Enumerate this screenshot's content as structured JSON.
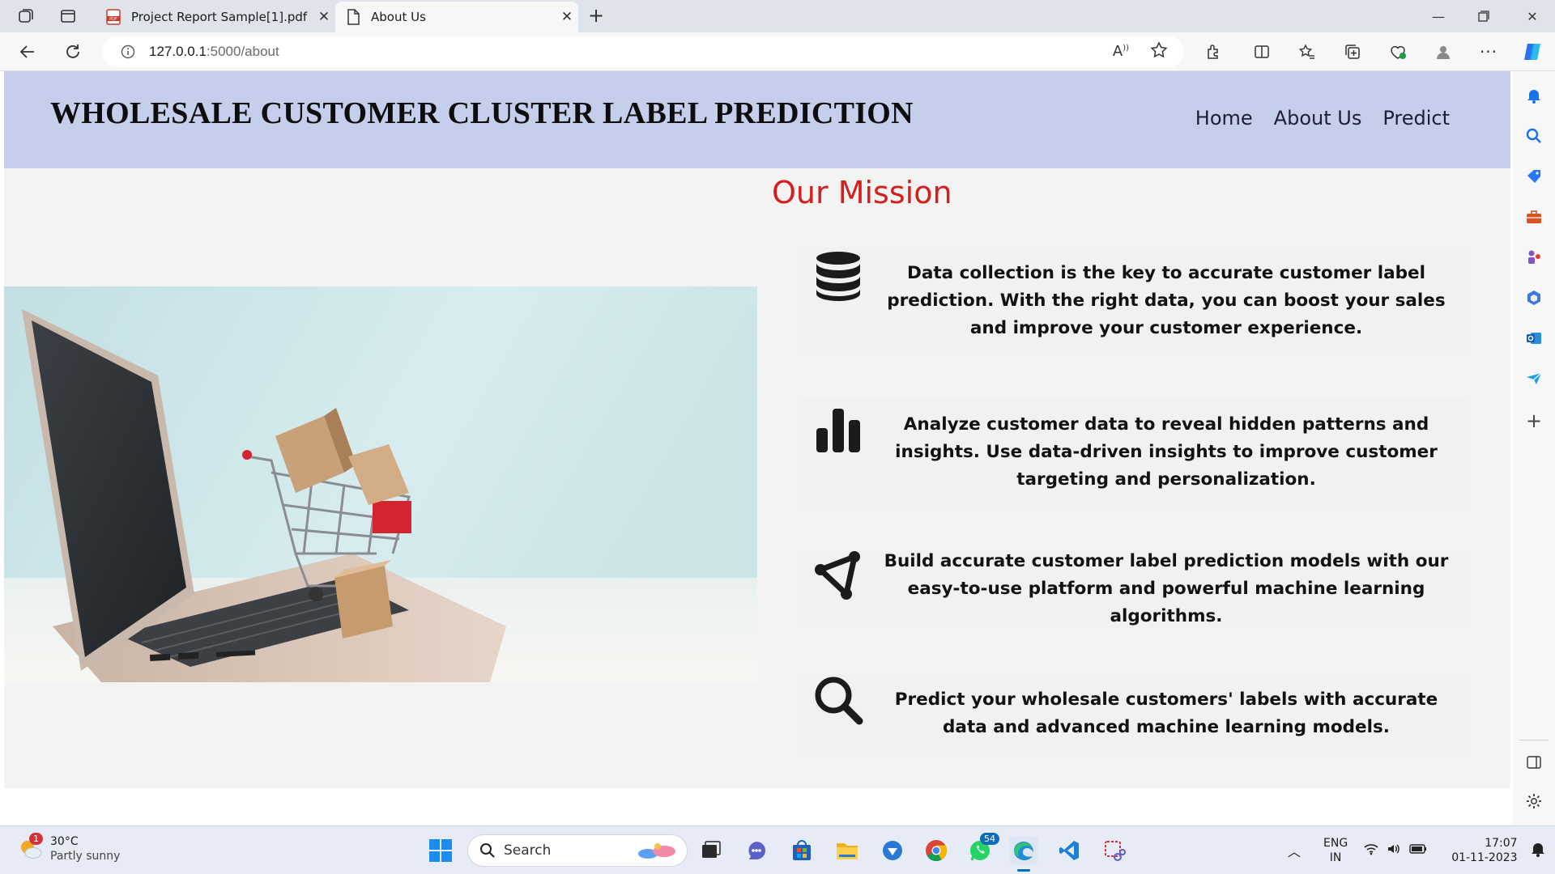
{
  "browser": {
    "tabs": [
      {
        "title": "Project Report Sample[1].pdf",
        "active": false
      },
      {
        "title": "About Us",
        "active": true
      }
    ],
    "url_host": "127.0.0.1",
    "url_path": ":5000/about"
  },
  "site": {
    "title": "WHOLESALE CUSTOMER CLUSTER LABEL PREDICTION",
    "nav": [
      "Home",
      "About Us",
      "Predict"
    ],
    "mission_heading": "Our Mission",
    "cards": [
      {
        "icon": "database-icon",
        "text": "Data collection is the key to accurate customer label prediction. With the right data, you can boost your sales and improve your customer experience."
      },
      {
        "icon": "bar-chart-icon",
        "text": "Analyze customer data to reveal hidden patterns and insights. Use data-driven insights to improve customer targeting and personalization."
      },
      {
        "icon": "network-icon",
        "text": "Build accurate customer label prediction models with our easy-to-use platform and powerful machine learning algorithms."
      },
      {
        "icon": "search-icon",
        "text": "Predict your wholesale customers' labels with accurate data and advanced machine learning models."
      }
    ]
  },
  "taskbar": {
    "weather_temp": "30°C",
    "weather_cond": "Partly sunny",
    "weather_badge": "1",
    "search_label": "Search",
    "whatsapp_badge": "54",
    "lang_1": "ENG",
    "lang_2": "IN",
    "time": "17:07",
    "date": "01-11-2023"
  },
  "colors": {
    "header_bg": "#c5cfec",
    "mission_heading": "#d21f1f",
    "page_bg": "#f3f3f3"
  }
}
